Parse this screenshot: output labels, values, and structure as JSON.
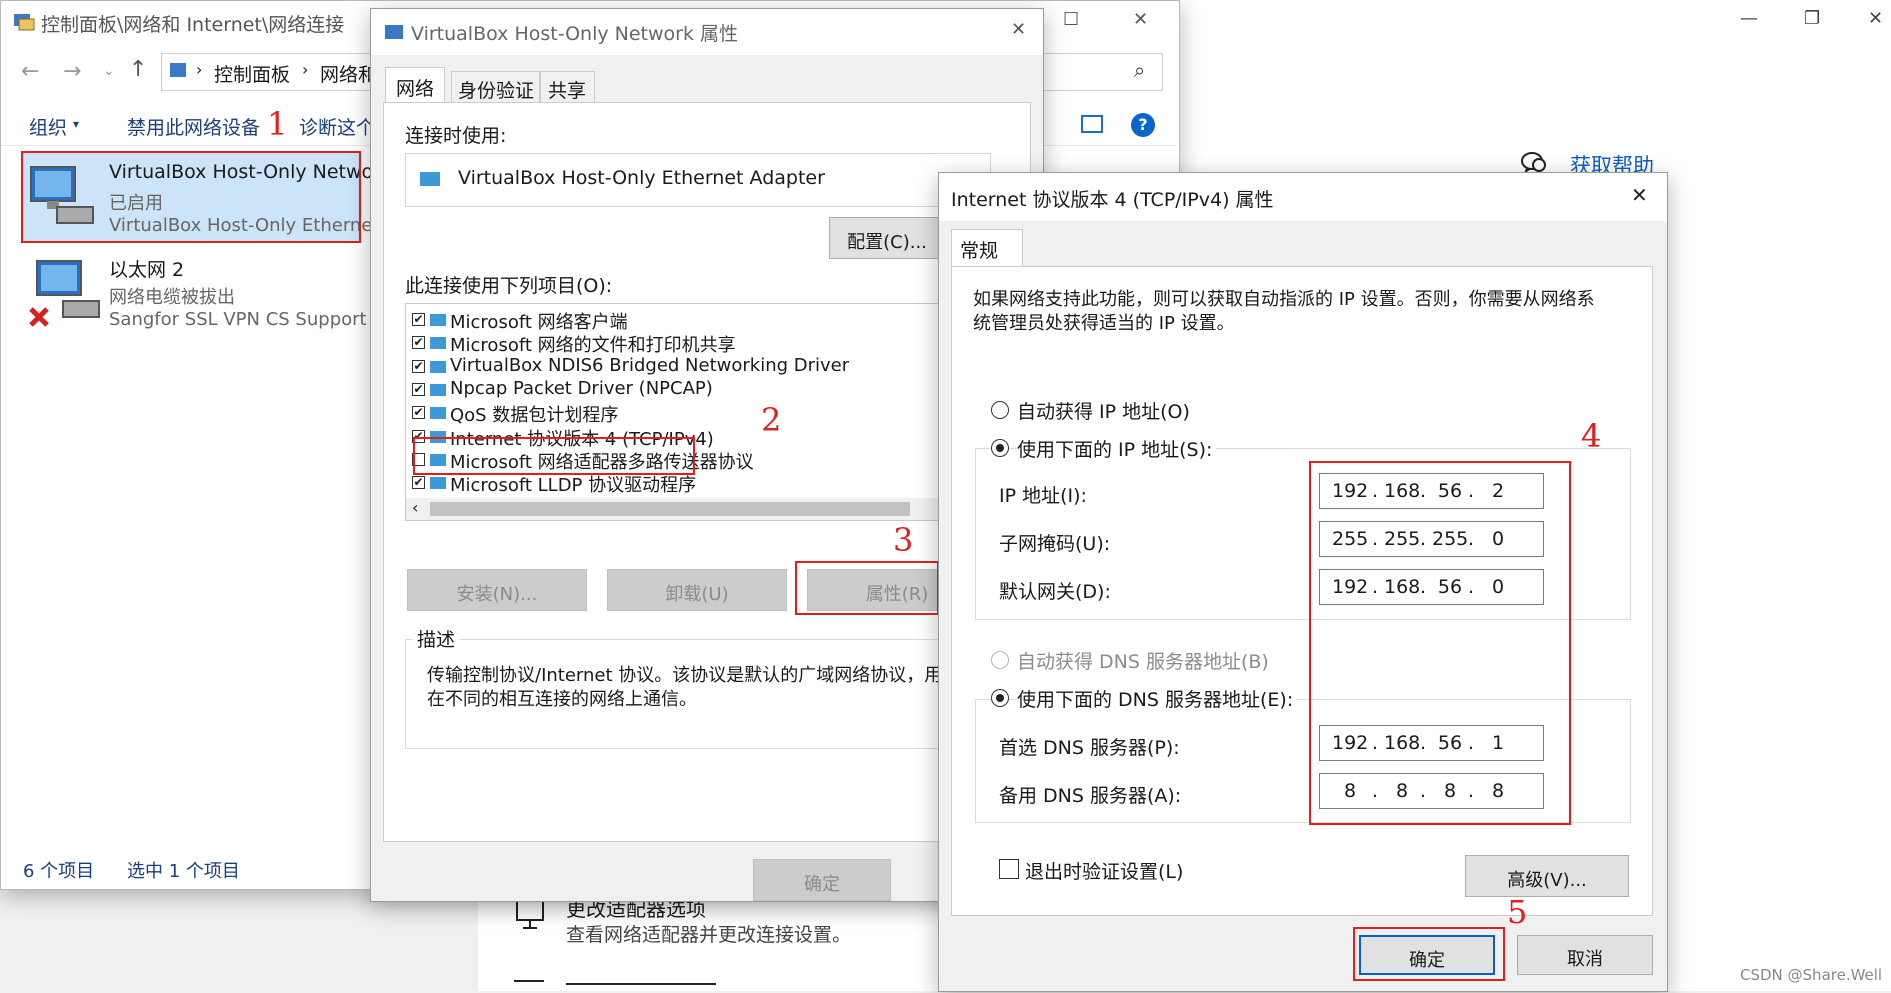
{
  "explorer": {
    "title": "控制面板\\网络和 Internet\\网络连接",
    "breadcrumb": [
      "控制面板",
      "网络和"
    ],
    "toolbar": {
      "organize": "组织",
      "disable": "禁用此网络设备",
      "diagnose": "诊断这个"
    },
    "items": [
      {
        "name": "VirtualBox Host-Only Network",
        "status": "已启用",
        "device": "VirtualBox Host-Only Ethernet"
      },
      {
        "name": "以太网 2",
        "status": "网络电缆被拔出",
        "device": "Sangfor SSL VPN CS Support S"
      }
    ],
    "statusbar": {
      "count": "6 个项目",
      "selected": "选中 1 个项目"
    }
  },
  "background": {
    "help_link": "获取帮助",
    "adapter_title": "更改适配器选项",
    "adapter_desc": "查看网络适配器并更改连接设置。",
    "watermark": "CSDN @Share.Well"
  },
  "props_dialog": {
    "title": "VirtualBox Host-Only Network 属性",
    "tabs": [
      "网络",
      "身份验证",
      "共享"
    ],
    "connect_using_label": "连接时使用:",
    "adapter": "VirtualBox Host-Only Ethernet Adapter",
    "configure_button": "配置(C)...",
    "items_label": "此连接使用下列项目(O):",
    "items": [
      {
        "label": "Microsoft 网络客户端",
        "checked": true
      },
      {
        "label": "Microsoft 网络的文件和打印机共享",
        "checked": true
      },
      {
        "label": "VirtualBox NDIS6 Bridged Networking Driver",
        "checked": true
      },
      {
        "label": "Npcap Packet Driver (NPCAP)",
        "checked": true
      },
      {
        "label": "QoS 数据包计划程序",
        "checked": true
      },
      {
        "label": "Internet 协议版本 4 (TCP/IPv4)",
        "checked": true
      },
      {
        "label": "Microsoft 网络适配器多路传送器协议",
        "checked": false
      },
      {
        "label": "Microsoft LLDP 协议驱动程序",
        "checked": true
      }
    ],
    "install_button": "安装(N)...",
    "uninstall_button": "卸载(U)",
    "properties_button": "属性(R)",
    "description_label": "描述",
    "description_line1": "传输控制协议/Internet 协议。该协议是默认的广域网络协议，用",
    "description_line2": "在不同的相互连接的网络上通信。",
    "ok_button": "确定"
  },
  "ipv4_dialog": {
    "title": "Internet 协议版本 4 (TCP/IPv4) 属性",
    "tab": "常规",
    "intro_line1": "如果网络支持此功能，则可以获取自动指派的 IP 设置。否则，你需要从网络系",
    "intro_line2": "统管理员处获得适当的 IP 设置。",
    "auto_ip_label": "自动获得 IP 地址(O)",
    "manual_ip_label": "使用下面的 IP 地址(S):",
    "ip_label": "IP 地址(I):",
    "ip_value": [
      "192",
      "168",
      "56",
      "2"
    ],
    "mask_label": "子网掩码(U):",
    "mask_value": [
      "255",
      "255",
      "255",
      "0"
    ],
    "gateway_label": "默认网关(D):",
    "gateway_value": [
      "192",
      "168",
      "56",
      "0"
    ],
    "auto_dns_label": "自动获得 DNS 服务器地址(B)",
    "manual_dns_label": "使用下面的 DNS 服务器地址(E):",
    "dns1_label": "首选 DNS 服务器(P):",
    "dns1_value": [
      "192",
      "168",
      "56",
      "1"
    ],
    "dns2_label": "备用 DNS 服务器(A):",
    "dns2_value": [
      "8",
      "8",
      "8",
      "8"
    ],
    "validate_label": "退出时验证设置(L)",
    "advanced_button": "高级(V)...",
    "ok_button": "确定",
    "cancel_button": "取消"
  },
  "annotations": [
    "1",
    "2",
    "3",
    "4",
    "5"
  ]
}
